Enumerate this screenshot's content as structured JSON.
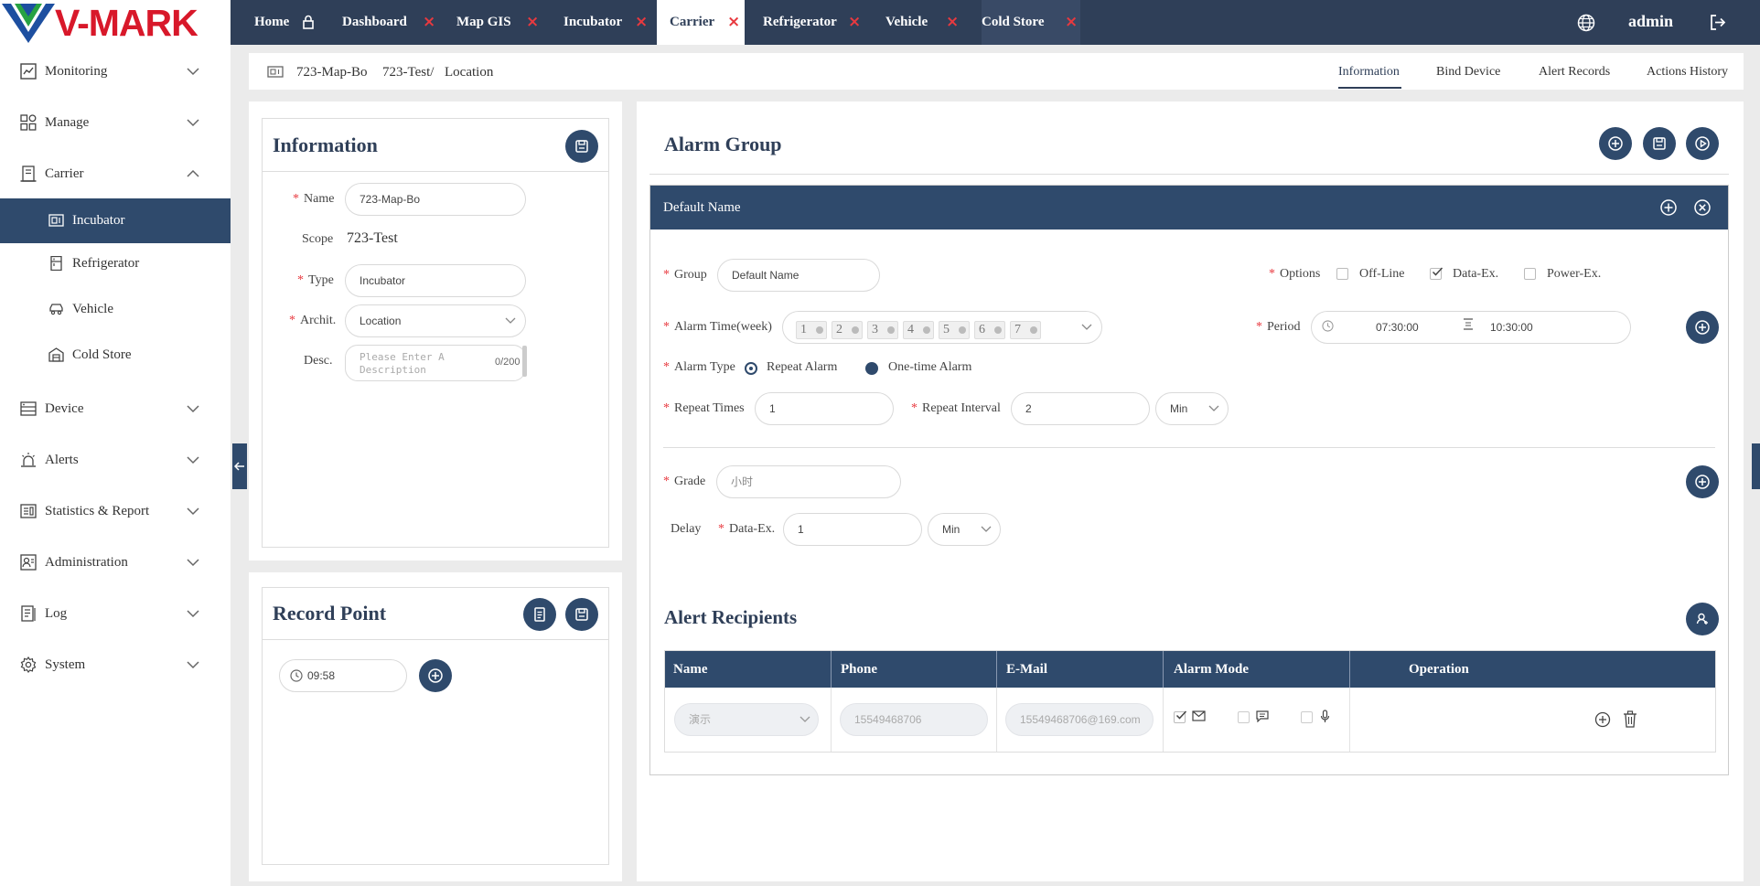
{
  "brand": {
    "logo_text": "V-MARK"
  },
  "tabs": [
    {
      "label": "Home"
    },
    {
      "label": "Dashboard"
    },
    {
      "label": "Map GIS"
    },
    {
      "label": "Incubator"
    },
    {
      "label": "Carrier"
    },
    {
      "label": "Refrigerator"
    },
    {
      "label": "Vehicle"
    },
    {
      "label": "Cold Store"
    }
  ],
  "tab_close_glyph": "×",
  "header": {
    "user": "admin"
  },
  "sidebar": {
    "items": [
      {
        "label": "Monitoring",
        "icon": "chart-icon"
      },
      {
        "label": "Manage",
        "icon": "grid-icon"
      },
      {
        "label": "Carrier",
        "icon": "carrier-icon"
      },
      {
        "label": "Device",
        "icon": "device-icon"
      },
      {
        "label": "Alerts",
        "icon": "alarm-icon"
      },
      {
        "label": "Statistics & Report",
        "icon": "report-icon"
      },
      {
        "label": "Administration",
        "icon": "admin-icon"
      },
      {
        "label": "Log",
        "icon": "log-icon"
      },
      {
        "label": "System",
        "icon": "gear-icon"
      }
    ],
    "carrier_sub": [
      {
        "label": "Incubator",
        "active": true
      },
      {
        "label": "Refrigerator"
      },
      {
        "label": "Vehicle"
      },
      {
        "label": "Cold Store"
      }
    ]
  },
  "breadcrumb": {
    "a": "723-Map-Bo",
    "b": "723-Test/",
    "c": "Location"
  },
  "page_tabs": [
    "Information",
    "Bind Device",
    "Alert Records",
    "Actions History"
  ],
  "info": {
    "title": "Information",
    "name_label": "Name",
    "name_value": "723-Map-Bo",
    "scope_label": "Scope",
    "scope_value": "723-Test",
    "type_label": "Type",
    "type_value": "Incubator",
    "archit_label": "Archit.",
    "archit_value": "Location",
    "desc_label": "Desc.",
    "desc_placeholder": "Please Enter A Description",
    "desc_count": "0/200",
    "required_mark": "*"
  },
  "record": {
    "title": "Record Point",
    "time": "09:58"
  },
  "alarm": {
    "title": "Alarm Group",
    "group_header": "Default Name",
    "group_label": "Group",
    "group_value": "Default Name",
    "options_label": "Options",
    "options": [
      {
        "label": "Off-Line",
        "checked": false
      },
      {
        "label": "Data-Ex.",
        "checked": true
      },
      {
        "label": "Power-Ex.",
        "checked": false
      }
    ],
    "time_label": "Alarm Time(week)",
    "days": [
      "1",
      "2",
      "3",
      "4",
      "5",
      "6",
      "7"
    ],
    "period_label": "Period",
    "period_start": "07:30:00",
    "period_end": "10:30:00",
    "type_label": "Alarm Type",
    "type_repeat": "Repeat Alarm",
    "type_once": "One-time Alarm",
    "repeat_times_label": "Repeat Times",
    "repeat_times": "1",
    "repeat_interval_label": "Repeat Interval",
    "repeat_interval": "2",
    "interval_unit": "Min",
    "grade_label": "Grade",
    "grade_value": "小时",
    "delay_label": "Delay",
    "delay_sub_label": "Data-Ex.",
    "delay_value": "1",
    "delay_unit": "Min"
  },
  "recipients": {
    "title": "Alert Recipients",
    "columns": [
      "Name",
      "Phone",
      "E-Mail",
      "Alarm Mode",
      "Operation"
    ],
    "row": {
      "name": "演示",
      "phone": "15549468706",
      "email": "15549468706@169.com"
    }
  },
  "colors": {
    "navy": "#2f3f58",
    "accent": "#2f4a6c",
    "close": "#e8393f"
  }
}
